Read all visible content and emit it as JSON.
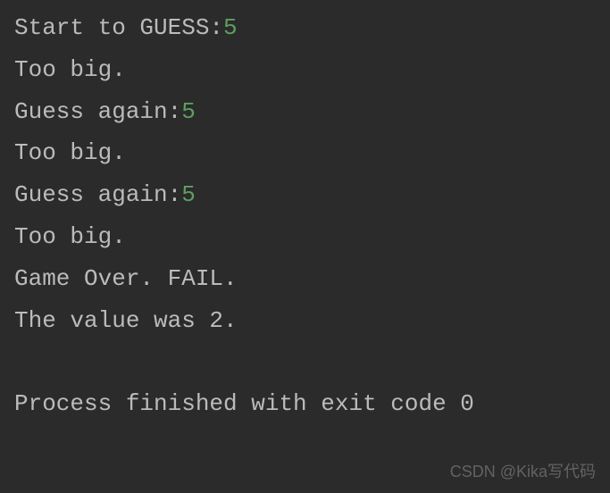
{
  "terminal": {
    "lines": [
      {
        "prompt": "Start to GUESS:",
        "input": "5"
      },
      {
        "prompt": "Too big.",
        "input": ""
      },
      {
        "prompt": "Guess again:",
        "input": "5"
      },
      {
        "prompt": "Too big.",
        "input": ""
      },
      {
        "prompt": "Guess again:",
        "input": "5"
      },
      {
        "prompt": "Too big.",
        "input": ""
      },
      {
        "prompt": "Game Over. FAIL.",
        "input": ""
      },
      {
        "prompt": "The value was 2.",
        "input": ""
      }
    ],
    "exit_line": "Process finished with exit code 0"
  },
  "watermark": "CSDN @Kika写代码"
}
